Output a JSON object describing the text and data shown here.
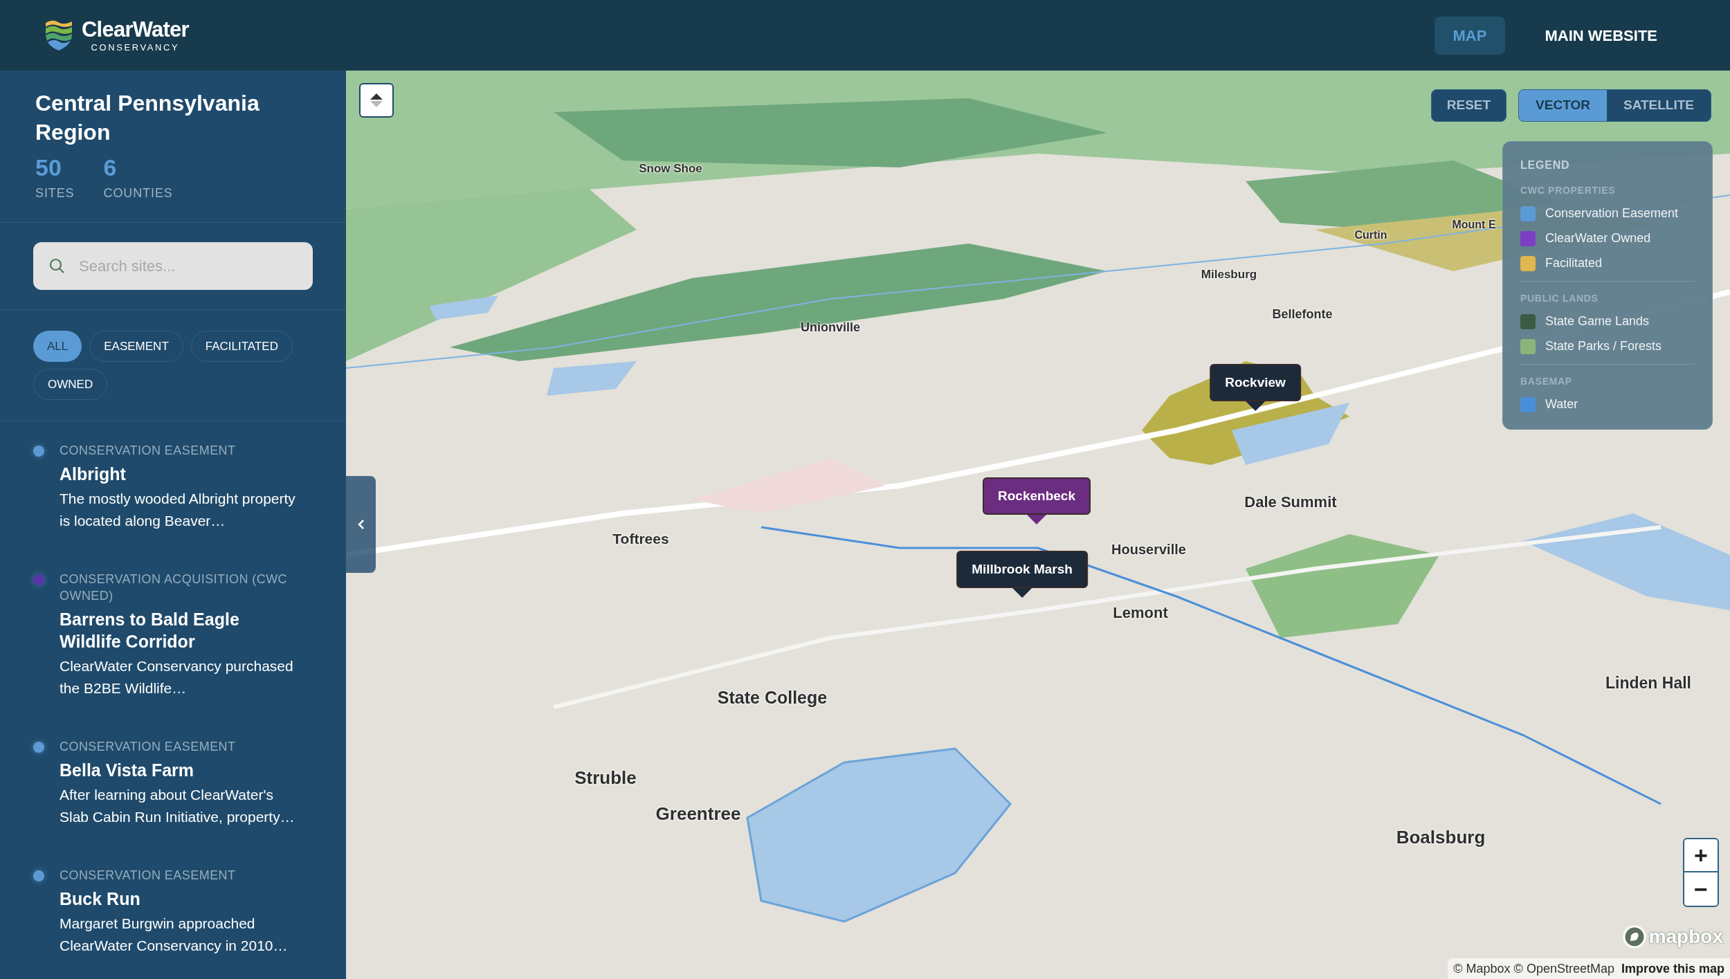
{
  "header": {
    "logo": {
      "name": "ClearWater",
      "tagline": "CONSERVANCY"
    },
    "nav": [
      {
        "label": "MAP",
        "selected": true
      },
      {
        "label": "MAIN WEBSITE",
        "selected": false
      }
    ]
  },
  "sidebar": {
    "title": "Central Pennsylvania Region",
    "stats": [
      {
        "value": "50",
        "label": "SITES"
      },
      {
        "value": "6",
        "label": "COUNTIES"
      }
    ],
    "search": {
      "placeholder": "Search sites..."
    },
    "filters": [
      {
        "label": "ALL",
        "selected": true
      },
      {
        "label": "EASEMENT",
        "selected": false
      },
      {
        "label": "FACILITATED",
        "selected": false
      },
      {
        "label": "OWNED",
        "selected": false
      }
    ],
    "sites": [
      {
        "category": "CONSERVATION EASEMENT",
        "name": "Albright",
        "description": "The mostly wooded Albright property is located along Beaver…",
        "color": "#5b9bd5"
      },
      {
        "category": "CONSERVATION ACQUISITION (CWC OWNED)",
        "name": "Barrens to Bald Eagle Wildlife Corridor",
        "description": "ClearWater Conservancy purchased the B2BE Wildlife…",
        "color": "#5a35a8"
      },
      {
        "category": "CONSERVATION EASEMENT",
        "name": "Bella Vista Farm",
        "description": "After learning about ClearWater's Slab Cabin Run Initiative, property…",
        "color": "#5b9bd5"
      },
      {
        "category": "CONSERVATION EASEMENT",
        "name": "Buck Run",
        "description": "Margaret Burgwin approached ClearWater Conservancy in 2010…",
        "color": "#5b9bd5"
      }
    ]
  },
  "map": {
    "reset": "RESET",
    "basemaps": [
      {
        "label": "VECTOR",
        "selected": true
      },
      {
        "label": "SATELLITE",
        "selected": false
      }
    ],
    "legend": {
      "title": "LEGEND",
      "sections": [
        {
          "title": "CWC PROPERTIES",
          "items": [
            {
              "label": "Conservation Easement",
              "color": "#5b9bd5"
            },
            {
              "label": "ClearWater Owned",
              "color": "#7b3fc4"
            },
            {
              "label": "Facilitated",
              "color": "#e0b64f"
            }
          ]
        },
        {
          "title": "PUBLIC LANDS",
          "items": [
            {
              "label": "State Game Lands",
              "color": "#3d5a45"
            },
            {
              "label": "State Parks / Forests",
              "color": "#8ab57a"
            }
          ]
        },
        {
          "title": "BASEMAP",
          "items": [
            {
              "label": "Water",
              "color": "#4a8fd9"
            }
          ]
        }
      ]
    },
    "place_labels": [
      "Snow Shoe",
      "Unionville",
      "Curtin",
      "Milesburg",
      "Bellefonte",
      "Mount E",
      "Toftrees",
      "Dale Summit",
      "Houserville",
      "Lemont",
      "State College",
      "Struble",
      "Greentree",
      "Boalsburg",
      "Linden Hall"
    ],
    "popups": [
      {
        "label": "Rockview",
        "color": "#1c2a3a"
      },
      {
        "label": "Rockenbeck",
        "color": "#6b2d80"
      },
      {
        "label": "Millbrook Marsh",
        "color": "#1c2a3a"
      }
    ],
    "zoom": {
      "in": "+",
      "out": "−"
    },
    "brand": "mapbox",
    "attribution": {
      "text": "© Mapbox © OpenStreetMap",
      "link": "Improve this map"
    }
  }
}
